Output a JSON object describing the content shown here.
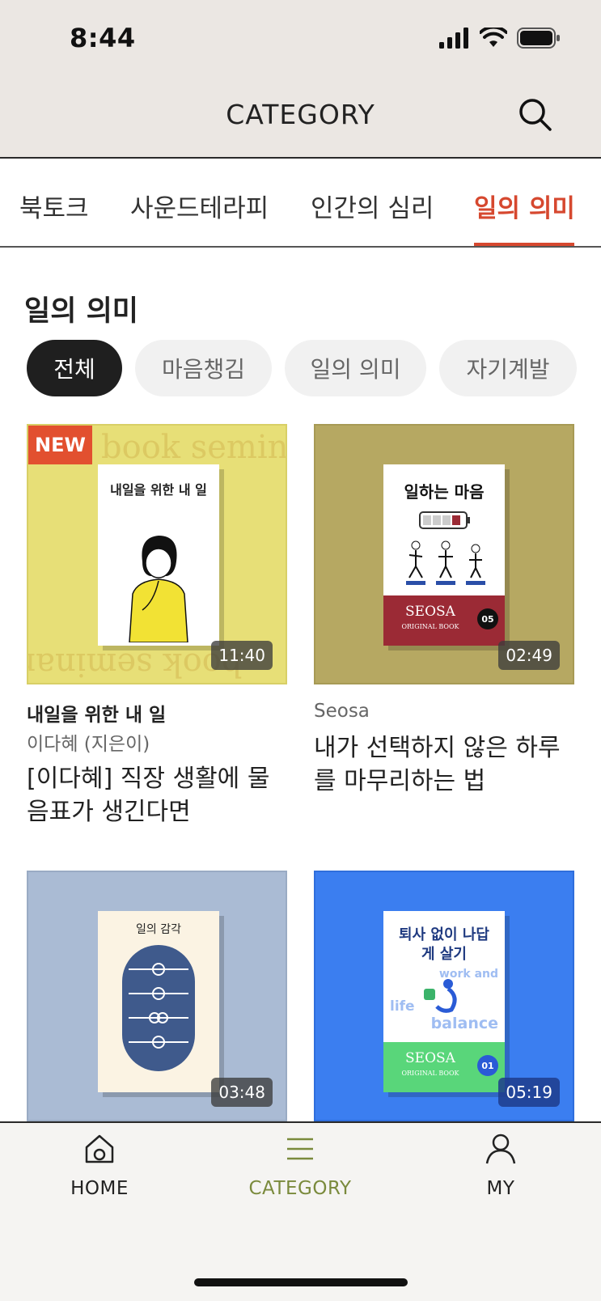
{
  "status_bar": {
    "time": "8:44"
  },
  "header": {
    "title": "CATEGORY"
  },
  "category_tabs": [
    {
      "label": "북토크"
    },
    {
      "label": "사운드테라피"
    },
    {
      "label": "인간의 심리"
    },
    {
      "label": "일의 의미",
      "active": true
    }
  ],
  "section": {
    "title": "일의 의미"
  },
  "filters": [
    {
      "label": "전체",
      "active": true
    },
    {
      "label": "마음챙김"
    },
    {
      "label": "일의 의미"
    },
    {
      "label": "자기계발"
    }
  ],
  "cards": [
    {
      "badge": "NEW",
      "duration": "11:40",
      "bg_color": "#e7df77",
      "cover_title": "내일을 위한 내 일",
      "bg_text": "book seminar",
      "author": "내일을 위한 내 일",
      "sub": "이다혜 (지은이)",
      "title": "[이다혜] 직장 생활에 물음표가 생긴다면"
    },
    {
      "duration": "02:49",
      "bg_color": "#b6a862",
      "cover_title": "일하는 마음",
      "cover_band": "SEOSA",
      "cover_band_sub": "ORIGINAL BOOK",
      "cover_num": "05",
      "sub": "Seosa",
      "title": "내가 선택하지 않은 하루를 마무리하는 법"
    },
    {
      "duration": "03:48",
      "bg_color": "#aabbd4",
      "cover_title": "일의 감각"
    },
    {
      "duration": "05:19",
      "bg_color": "#3b7ef0",
      "cover_title": "퇴사 없이 나답게 살기",
      "cover_text_2": "work and",
      "cover_text_3": "life",
      "cover_text_4": "balance",
      "cover_band": "SEOSA",
      "cover_band_sub": "ORIGINAL BOOK",
      "cover_num": "01"
    }
  ],
  "bottom_nav": [
    {
      "label": "HOME",
      "icon": "home-icon"
    },
    {
      "label": "CATEGORY",
      "icon": "menu-icon",
      "active": true
    },
    {
      "label": "MY",
      "icon": "user-icon"
    }
  ]
}
